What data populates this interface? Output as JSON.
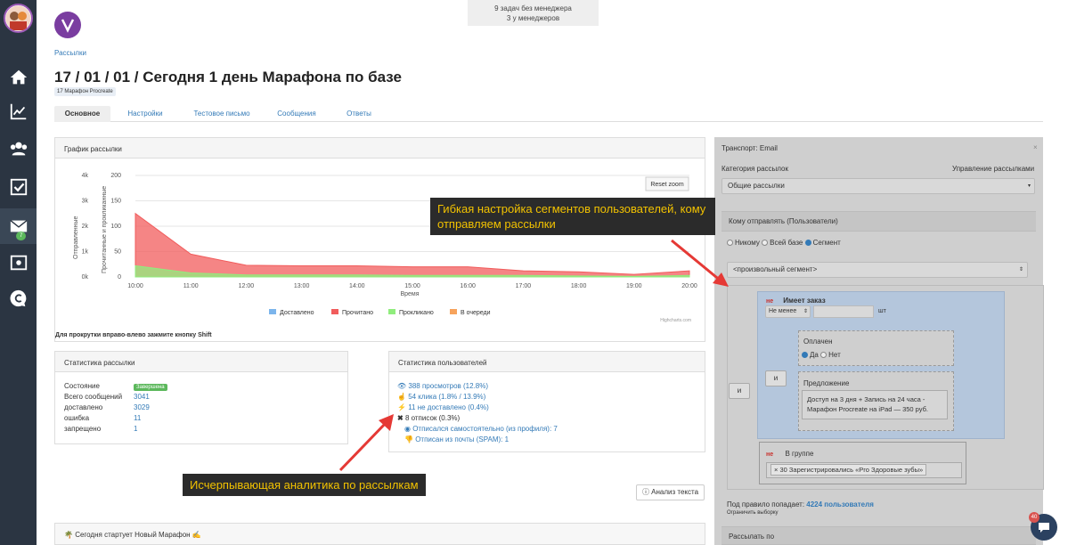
{
  "notice": {
    "line1": "9 задач без менеджера",
    "line2": "3 у менеджеров"
  },
  "sidebar": {
    "mail_badge": "7"
  },
  "breadcrumb": "Рассылки",
  "page_title": "17 / 01 / 01 / Сегодня 1 день Марафона по базе",
  "tag": "17 Марафон Procreate",
  "tabs": [
    "Основное",
    "Настройки",
    "Тестовое письмо",
    "Сообщения",
    "Ответы"
  ],
  "chart_panel": {
    "title": "График рассылки",
    "reset_zoom": "Reset zoom",
    "hint": "Для прокрутки вправо-влево зажмите кнопку Shift",
    "credits": "Highcharts.com"
  },
  "chart_data": {
    "type": "area",
    "x": [
      "10:00",
      "11:00",
      "12:00",
      "13:00",
      "14:00",
      "15:00",
      "16:00",
      "17:00",
      "18:00",
      "19:00",
      "20:00"
    ],
    "xlabel": "Время",
    "ylabel_left": "Отправленные",
    "ylabel_right": "Прочитанные и прокликанные",
    "yleft_ticks": [
      "4k",
      "3k",
      "2k",
      "1k",
      "0k"
    ],
    "yright_ticks": [
      "200",
      "150",
      "100",
      "50",
      "0"
    ],
    "yright_lim": [
      0,
      200
    ],
    "series": [
      {
        "name": "Доставлено",
        "color": "#7cb5ec",
        "values": [
          0,
          0,
          0,
          0,
          0,
          0,
          0,
          0,
          0,
          0,
          0
        ]
      },
      {
        "name": "Прочитано",
        "color": "#f15c5c",
        "values": [
          125,
          45,
          23,
          22,
          22,
          20,
          20,
          12,
          10,
          5,
          12
        ]
      },
      {
        "name": "Проклкано",
        "color": "#90ed7d",
        "values": [
          22,
          8,
          4,
          4,
          4,
          3,
          3,
          3,
          2,
          1,
          3
        ]
      },
      {
        "name": "В очереди",
        "color": "#f7a35c",
        "values": [
          0,
          0,
          0,
          0,
          0,
          0,
          0,
          0,
          0,
          0,
          0
        ]
      }
    ],
    "legend": [
      "Доставлено",
      "Прочитано",
      "Прокликано",
      "В очереди"
    ],
    "legend_position": "bottom"
  },
  "stats": {
    "title": "Статистика рассылки",
    "rows": [
      {
        "label": "Состояние",
        "value": "Завершена"
      },
      {
        "label": "Всего сообщений",
        "value": "3041"
      },
      {
        "label": "доставлено",
        "value": "3029"
      },
      {
        "label": "ошибка",
        "value": "11"
      },
      {
        "label": "запрещено",
        "value": "1"
      }
    ]
  },
  "users": {
    "title": "Статистика пользователей",
    "views": "388 просмотров (12.8%)",
    "clicks": "54 клика (1.8% / 13.9%)",
    "not_delivered": "11 не доставлено (0.4%)",
    "unsub": "8 отписок (0.3%)",
    "self_unsub": "Отписался самостоятельно (из профиля): 7",
    "spam_unsub": "Отписан из почты (SPAM): 1"
  },
  "analyze_button": "Анализ текста",
  "marathon_bar": "Сегодня стартует Новый Марафон",
  "right": {
    "transport": "Транспорт: Email",
    "category_label": "Категория рассылок",
    "manage_link": "Управление рассылками",
    "category_value": "Общие рассылки",
    "send_to": "Кому отправлять (Пользователи)",
    "radio": [
      "Никому",
      "Всей базе",
      "Сегмент"
    ],
    "segment_select": "<произвольный сегмент>",
    "and": "и",
    "ne": "не",
    "has_order": "Имеет заказ",
    "not_less": "Не менее",
    "pcs": "шт",
    "paid": "Оплачен",
    "yes": "Да",
    "no": "Нет",
    "offer": "Предложение",
    "offer_value": "Доступ на 3 дня + Запись на 24 часа - Марафон Procreate на iPad — 350 руб.",
    "in_group": "В группе",
    "group_value": "× 30 Зарегистрировались «Pro Здоровые зубы»",
    "rule_count_prefix": "Под правило попадает:",
    "rule_count": "4224 пользователя",
    "limit_link": "Ограничить выборку",
    "send_by": "Рассылать по"
  },
  "callouts": {
    "segments": "Гибкая настройка сегментов пользователей, кому отправляем рассылки",
    "analytics": "Исчерпывающая аналитика по рассылкам"
  },
  "chat_badge": "40"
}
